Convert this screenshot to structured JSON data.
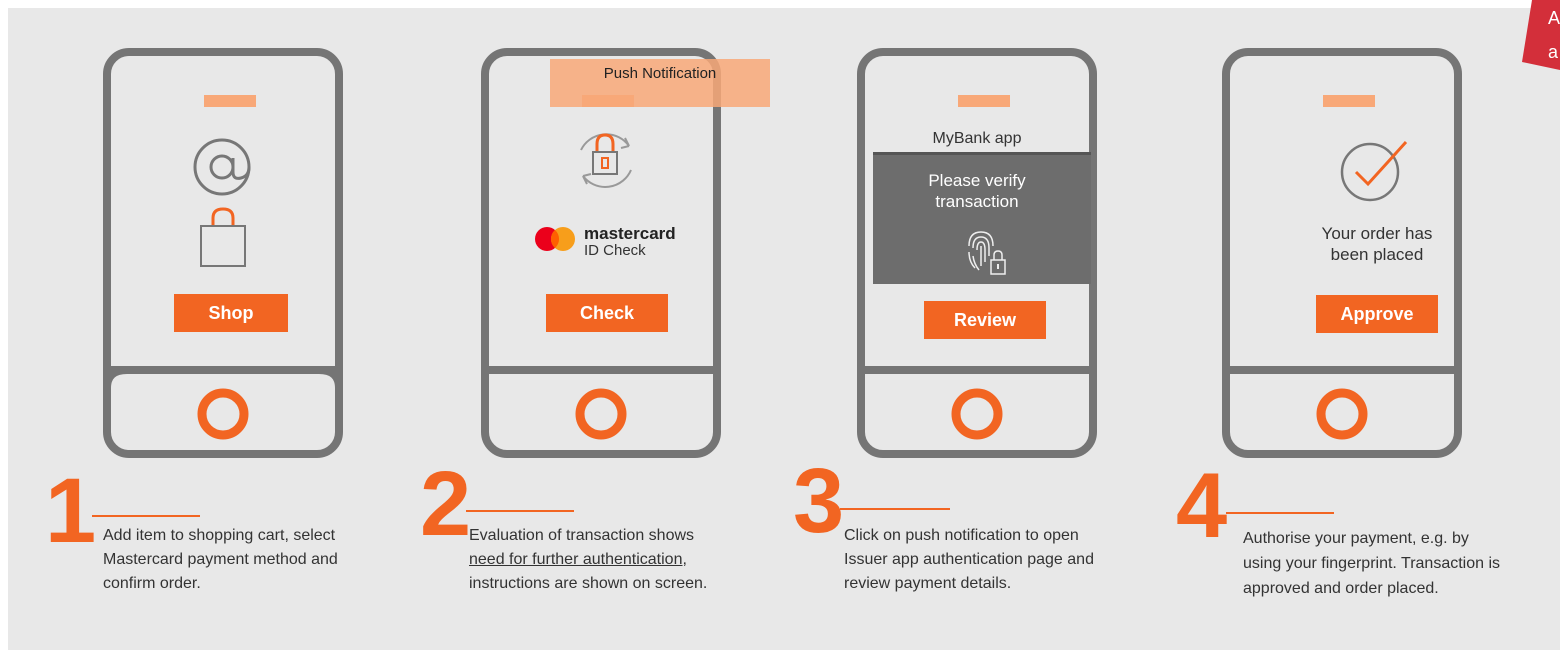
{
  "steps": [
    {
      "number": "1",
      "button": "Shop",
      "description": "Add item to shopping cart, select Mastercard payment method and confirm order."
    },
    {
      "number": "2",
      "button": "Check",
      "notification": "Push Notification",
      "brand_name": "mastercard",
      "brand_sub": "ID Check",
      "description_pre": "Evaluation of  transaction shows ",
      "description_underlined": "need for further authentication, ",
      "description_post": "instructions are shown on screen."
    },
    {
      "number": "3",
      "button": "Review",
      "app_title": "MyBank app",
      "prompt": "Please verify transaction",
      "description": "Click on push notification to open Issuer app authentication page and review payment details."
    },
    {
      "number": "4",
      "button": "Approve",
      "confirmation": "Your order has been placed",
      "description": "Authorise your payment, e.g. by using your fingerprint. Transaction is approved and order placed."
    }
  ],
  "corner_label": {
    "line1": "A",
    "line2": "a"
  },
  "colors": {
    "accent": "#f26522",
    "accent_light": "#f8a878",
    "phone_outline": "#757575",
    "panel_bg": "#e8e8e8",
    "dark_card": "#6d6d6d",
    "corner_red": "#d32f3a"
  }
}
